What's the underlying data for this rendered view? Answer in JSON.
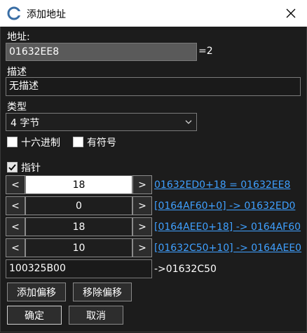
{
  "window": {
    "title": "添加地址",
    "close_icon": "close-icon",
    "app_icon": "cheat-engine-icon"
  },
  "address": {
    "label": "地址:",
    "value": "01632EE8",
    "result": "=2"
  },
  "description": {
    "label": "描述",
    "value": "无描述"
  },
  "type": {
    "label": "类型",
    "selected": "4 字节"
  },
  "options": {
    "hex_label": "十六进制",
    "signed_label": "有符号",
    "hex_checked": false,
    "signed_checked": false
  },
  "pointer": {
    "label": "指针",
    "checked": true,
    "offsets": [
      {
        "dec": "<",
        "value": "18",
        "inc": ">",
        "info": "01632ED0+18 = 01632EE8"
      },
      {
        "dec": "<",
        "value": "0",
        "inc": ">",
        "info": "[0164AF60+0] -> 01632ED0"
      },
      {
        "dec": "<",
        "value": "18",
        "inc": ">",
        "info": "[0164AEE0+18] -> 0164AF60"
      },
      {
        "dec": "<",
        "value": "10",
        "inc": ">",
        "info": "[01632C50+10] -> 0164AEE0"
      }
    ],
    "base_address": "100325B00",
    "base_result": "->01632C50"
  },
  "buttons": {
    "add_offset": "添加偏移",
    "remove_offset": "移除偏移",
    "ok": "确定",
    "cancel": "取消"
  }
}
